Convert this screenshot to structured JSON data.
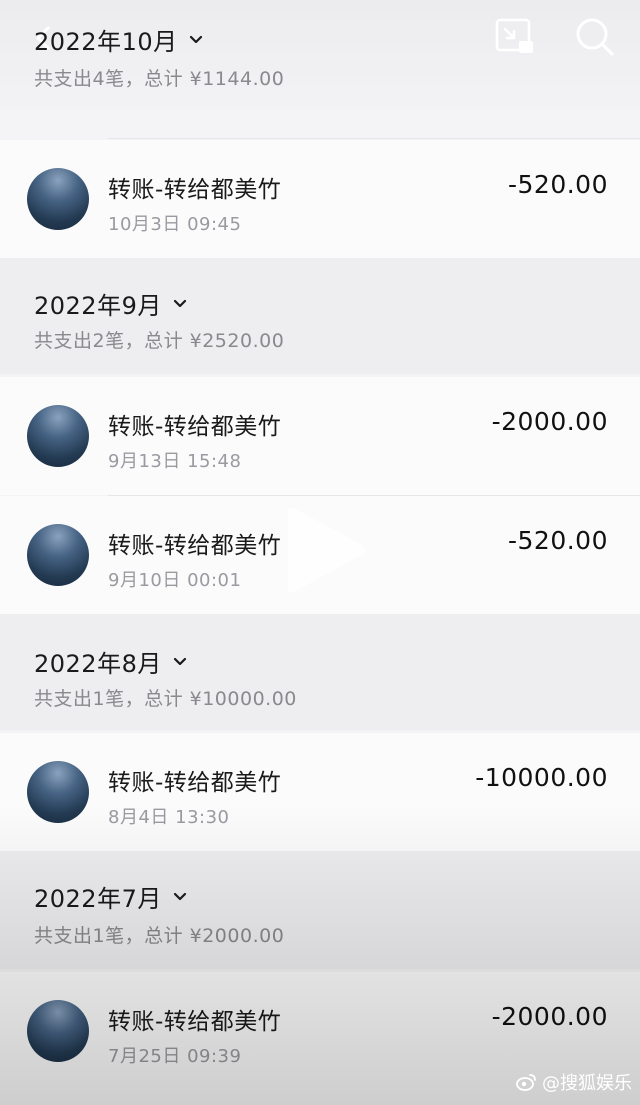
{
  "header": {
    "icons": [
      "back-icon",
      "picture-in-picture-icon",
      "search-icon"
    ]
  },
  "sections": [
    {
      "month": "2022年10月",
      "summary": "共支出4笔，总计 ¥1144.00",
      "transactions": [
        {
          "title": "转账-转给都美竹",
          "time": "10月3日 09:45",
          "amount": "-520.00"
        }
      ]
    },
    {
      "month": "2022年9月",
      "summary": "共支出2笔，总计 ¥2520.00",
      "transactions": [
        {
          "title": "转账-转给都美竹",
          "time": "9月13日 15:48",
          "amount": "-2000.00"
        },
        {
          "title": "转账-转给都美竹",
          "time": "9月10日 00:01",
          "amount": "-520.00"
        }
      ]
    },
    {
      "month": "2022年8月",
      "summary": "共支出1笔，总计 ¥10000.00",
      "transactions": [
        {
          "title": "转账-转给都美竹",
          "time": "8月4日 13:30",
          "amount": "-10000.00"
        }
      ]
    },
    {
      "month": "2022年7月",
      "summary": "共支出1笔，总计 ¥2000.00",
      "transactions": [
        {
          "title": "转账-转给都美竹",
          "time": "7月25日 09:39",
          "amount": "-2000.00"
        }
      ]
    }
  ],
  "watermark": {
    "text": "@搜狐娱乐",
    "icon": "weibo-icon"
  },
  "colors": {
    "background": "#f4f4f6",
    "row": "#fbfbfc",
    "secondary_text": "#8a8a8e"
  }
}
